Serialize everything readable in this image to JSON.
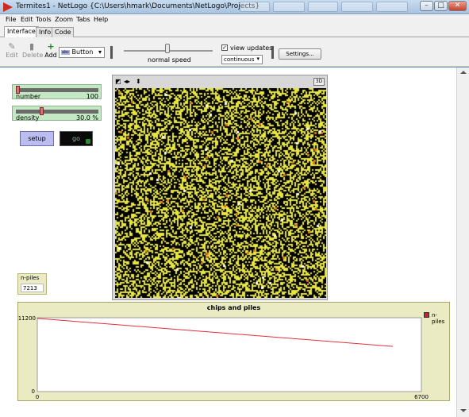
{
  "window": {
    "title": "Termites1 - NetLogo {C:\\Users\\hmark\\Documents\\NetLogo\\Projects}",
    "minimize": "–",
    "maximize": "□",
    "close": "✕"
  },
  "menu": [
    "File",
    "Edit",
    "Tools",
    "Zoom",
    "Tabs",
    "Help"
  ],
  "tabs": [
    "Interface",
    "Info",
    "Code"
  ],
  "toolbar": {
    "edit": "Edit",
    "delete": "Delete",
    "add": "Add",
    "widget_type": "Button",
    "speed_label": "normal speed",
    "speed_fraction": 0.5,
    "view_updates_label": "view updates",
    "view_updates_checked": true,
    "update_mode": "continuous",
    "settings": "Settings..."
  },
  "sliders": [
    {
      "name": "number",
      "value": "100",
      "fraction": 0.0
    },
    {
      "name": "density",
      "value": "30.0 %",
      "fraction": 0.3
    }
  ],
  "buttons": {
    "setup": "setup",
    "go": "go"
  },
  "view": {
    "btn_3d": "3D",
    "chip_density": 0.3
  },
  "monitor": {
    "label": "n-piles",
    "value": "7213"
  },
  "plot": {
    "title": "chips and piles",
    "legend": "n-piles"
  },
  "chart_data": {
    "type": "line",
    "title": "chips and piles",
    "xlabel": "",
    "ylabel": "",
    "xlim": [
      0,
      6700
    ],
    "ylim": [
      0,
      11200
    ],
    "x_tick_labels": [
      "0",
      "6700"
    ],
    "y_tick_labels": [
      "0",
      "11200"
    ],
    "series": [
      {
        "name": "n-piles",
        "color": "#e0303a",
        "x": [
          0,
          6200
        ],
        "y": [
          11100,
          6850
        ]
      }
    ],
    "legend_position": "top-right"
  },
  "colors": {
    "chip": "#e8e63a",
    "pile_chip": "#d9781e",
    "termite": "#ffffff",
    "series": "#e0303a"
  }
}
